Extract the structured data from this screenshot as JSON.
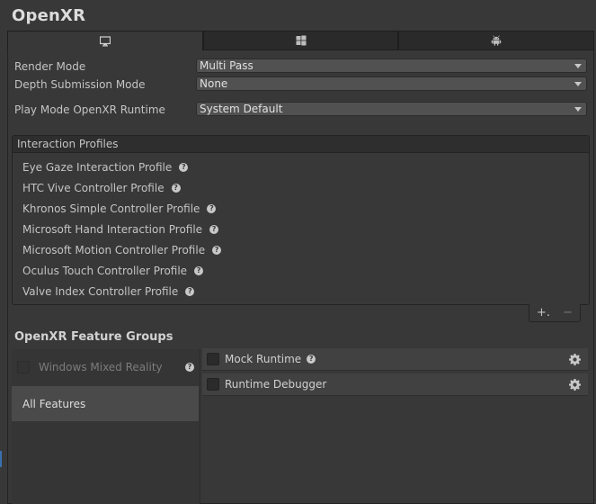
{
  "title": "OpenXR",
  "tabs": [
    {
      "name": "desktop-icon",
      "active": true
    },
    {
      "name": "windows-icon",
      "active": false
    },
    {
      "name": "android-icon",
      "active": false
    }
  ],
  "properties": {
    "render_mode": {
      "label": "Render Mode",
      "value": "Multi Pass"
    },
    "depth_submission": {
      "label": "Depth Submission Mode",
      "value": "None"
    },
    "play_mode_runtime": {
      "label": "Play Mode OpenXR Runtime",
      "value": "System Default"
    }
  },
  "interaction_profiles": {
    "header": "Interaction Profiles",
    "items": [
      "Eye Gaze Interaction Profile",
      "HTC Vive Controller Profile",
      "Khronos Simple Controller Profile",
      "Microsoft Hand Interaction Profile",
      "Microsoft Motion Controller Profile",
      "Oculus Touch Controller Profile",
      "Valve Index Controller Profile"
    ],
    "add_label": "+.",
    "remove_label": "−"
  },
  "feature_groups": {
    "title": "OpenXR Feature Groups",
    "groups": [
      {
        "label": "Windows Mixed Reality",
        "checked": false,
        "enabled": false
      }
    ],
    "all_features_label": "All Features",
    "features": [
      {
        "label": "Mock Runtime",
        "checked": false,
        "has_help": true
      },
      {
        "label": "Runtime Debugger",
        "checked": false,
        "has_help": false
      }
    ]
  },
  "help_glyph": "?",
  "colors": {
    "background": "#383838",
    "selected": "#4a4a4a",
    "accent": "#3a6fb0"
  }
}
